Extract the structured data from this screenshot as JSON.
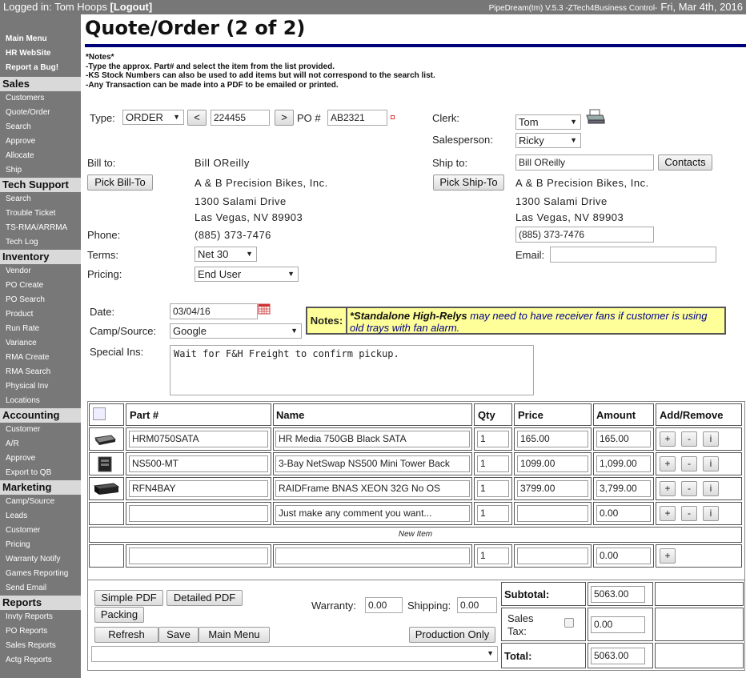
{
  "topbar": {
    "logged_in": "Logged in: Tom Hoops",
    "logout": "[Logout]",
    "app": "PipeDream(tm) V.5.3 -ZTech4Business Control-",
    "date": "Fri, Mar 4th, 2016"
  },
  "sidebar": {
    "top_links": [
      "Main Menu",
      "HR WebSite",
      "Report a Bug!"
    ],
    "sections": [
      {
        "title": "Sales",
        "items": [
          "Customers",
          "Quote/Order",
          "Search",
          "Approve",
          "Allocate",
          "Ship"
        ]
      },
      {
        "title": "Tech Support",
        "items": [
          "Search",
          "Trouble Ticket",
          "TS-RMA/ARRMA",
          "Tech Log"
        ]
      },
      {
        "title": "Inventory",
        "items": [
          "Vendor",
          "PO Create",
          "PO Search",
          "Product",
          "Run Rate",
          "Variance",
          "RMA Create",
          "RMA Search",
          "Physical Inv",
          "Locations"
        ]
      },
      {
        "title": "Accounting",
        "items": [
          "Customer",
          "A/R",
          "Approve",
          "Export to QB"
        ]
      },
      {
        "title": "Marketing",
        "items": [
          "Camp/Source",
          "Leads",
          "Customer",
          "Pricing",
          "Warranty Notify",
          "Games Reporting",
          "Send Email"
        ]
      },
      {
        "title": "Reports",
        "items": [
          "Invty Reports",
          "PO Reports",
          "Sales Reports",
          "Actg Reports"
        ]
      }
    ]
  },
  "page": {
    "title": "Quote/Order (2 of 2)",
    "notes": [
      "*Notes*",
      "-Type the approx. Part# and select the item from the list provided.",
      "-KS Stock Numbers can also be used to add items but will not correspond to the search list.",
      "-Any Transaction can be made into a PDF to be emailed or printed."
    ]
  },
  "form": {
    "type_label": "Type:",
    "type_value": "ORDER",
    "prev": "<",
    "order_number": "224455",
    "next": ">",
    "po_label": "PO #",
    "po_value": "AB2321",
    "clerk_label": "Clerk:",
    "clerk_value": "Tom",
    "salesperson_label": "Salesperson:",
    "salesperson_value": "Ricky",
    "bill_to_label": "Bill to:",
    "bill_to_name": "Bill OReilly",
    "pick_bill_to": "Pick Bill-To",
    "bill_company": "A & B Precision Bikes, Inc.",
    "bill_address1": "1300 Salami Drive",
    "bill_address2": "Las Vegas, NV 89903",
    "ship_to_label": "Ship to:",
    "ship_to_name": "Bill OReilly",
    "contacts": "Contacts",
    "pick_ship_to": "Pick Ship-To",
    "ship_company": "A & B Precision Bikes, Inc.",
    "ship_address1": "1300 Salami Drive",
    "ship_address2": "Las Vegas, NV 89903",
    "phone_label": "Phone:",
    "phone_value": "(885) 373-7476",
    "ship_phone": "(885) 373-7476",
    "terms_label": "Terms:",
    "terms_value": "Net 30",
    "email_label": "Email:",
    "email_value": "",
    "pricing_label": "Pricing:",
    "pricing_value": "End User",
    "date_label": "Date:",
    "date_value": "03/04/16",
    "camp_label": "Camp/Source:",
    "camp_value": "Google",
    "special_label": "Special Ins:",
    "special_value": "Wait for F&H Freight to confirm pickup.",
    "notes_label": "Notes:",
    "notes_bold": "*Standalone High-Relys",
    "notes_text": " may need to have receiver fans if customer is using old trays with fan alarm."
  },
  "items": {
    "headers": [
      "Part #",
      "Name",
      "Qty",
      "Price",
      "Amount",
      "Add/Remove"
    ],
    "rows": [
      {
        "part": "HRM0750SATA",
        "name": "HR Media 750GB Black SATA",
        "qty": "1",
        "price": "165.00",
        "amount": "165.00"
      },
      {
        "part": "NS500-MT",
        "name": "3-Bay NetSwap NS500 Mini Tower Back",
        "qty": "1",
        "price": "1099.00",
        "amount": "1,099.00"
      },
      {
        "part": "RFN4BAY",
        "name": "RAIDFrame BNAS XEON 32G No OS",
        "qty": "1",
        "price": "3799.00",
        "amount": "3,799.00"
      },
      {
        "part": "",
        "name": "Just make any comment you want...",
        "qty": "1",
        "price": "",
        "amount": "0.00"
      }
    ],
    "new_item_label": "New Item",
    "new_row": {
      "part": "",
      "name": "",
      "qty": "1",
      "price": "",
      "amount": "0.00"
    },
    "plus": "+",
    "minus": "-",
    "info": "i"
  },
  "footer": {
    "simple_pdf": "Simple PDF",
    "detailed_pdf": "Detailed PDF",
    "packing": "Packing",
    "refresh": "Refresh",
    "save": "Save",
    "main_menu": "Main Menu",
    "warranty_label": "Warranty:",
    "warranty_value": "0.00",
    "shipping_label": "Shipping:",
    "shipping_value": "0.00",
    "production_only": "Production Only",
    "subtotal_label": "Subtotal:",
    "subtotal_value": "5063.00",
    "sales_tax_label": "Sales Tax:",
    "sales_tax_value": "0.00",
    "total_label": "Total:",
    "total_value": "5063.00"
  }
}
